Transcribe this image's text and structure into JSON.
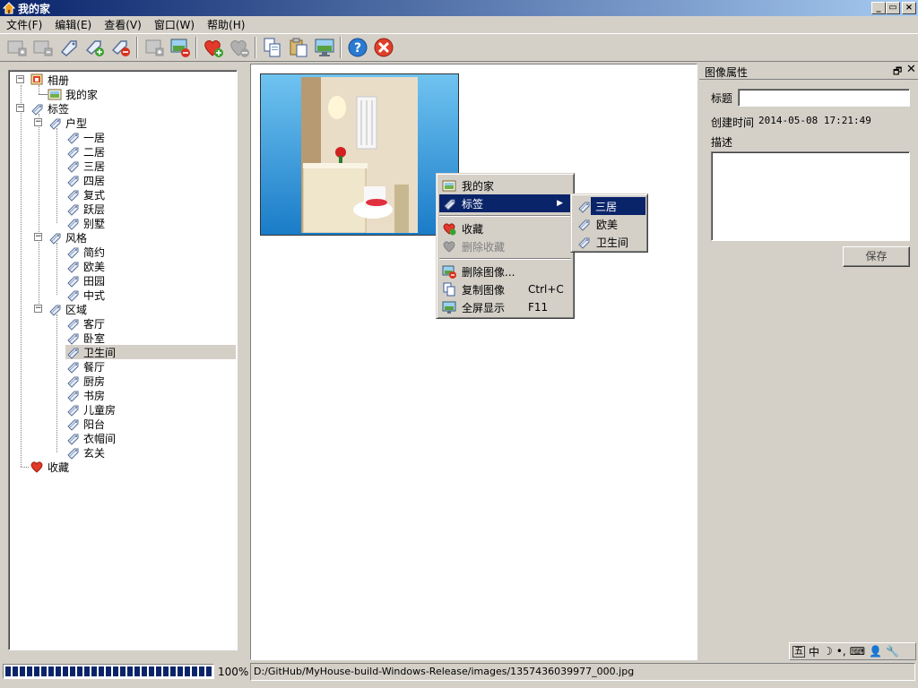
{
  "window": {
    "title": "我的家"
  },
  "menubar": {
    "items": [
      "文件(F)",
      "编辑(E)",
      "查看(V)",
      "窗口(W)",
      "帮助(H)"
    ]
  },
  "toolbar": {
    "buttons": [
      "new-album-icon",
      "remove-album-icon",
      "tag-icon",
      "add-tag-icon",
      "remove-tag-icon",
      "import-icon",
      "delete-image-icon",
      "add-favorite-icon",
      "remove-favorite-icon",
      "copy-icon",
      "paste-icon",
      "fullscreen-icon",
      "help-icon",
      "close-icon"
    ]
  },
  "tree": {
    "albums": {
      "label": "相册",
      "items": [
        "我的家"
      ]
    },
    "tags": {
      "label": "标签",
      "groups": [
        {
          "label": "户型",
          "items": [
            "一居",
            "二居",
            "三居",
            "四居",
            "复式",
            "跃层",
            "别墅"
          ]
        },
        {
          "label": "风格",
          "items": [
            "简约",
            "欧美",
            "田园",
            "中式"
          ]
        },
        {
          "label": "区域",
          "items": [
            "客厅",
            "卧室",
            "卫生间",
            "餐厅",
            "厨房",
            "书房",
            "儿童房",
            "阳台",
            "衣帽间",
            "玄关"
          ]
        }
      ]
    },
    "favorites": {
      "label": "收藏"
    },
    "selected": "卫生间"
  },
  "context_menu": {
    "items": [
      {
        "label": "我的家",
        "icon": "album-icon"
      },
      {
        "label": "标签",
        "icon": "tag-icon",
        "submenu": true
      },
      {
        "label": "收藏",
        "icon": "add-favorite-icon"
      },
      {
        "label": "删除收藏",
        "icon": "remove-favorite-icon",
        "disabled": true
      },
      {
        "label": "删除图像...",
        "icon": "delete-image-icon"
      },
      {
        "label": "复制图像",
        "shortcut": "Ctrl+C",
        "icon": "copy-icon"
      },
      {
        "label": "全屏显示",
        "shortcut": "F11",
        "icon": "fullscreen-icon"
      }
    ],
    "submenu": [
      "三居",
      "欧美",
      "卫生间"
    ]
  },
  "properties": {
    "panel_title": "图像属性",
    "title_label": "标题",
    "title_value": "",
    "created_label": "创建时间",
    "created_value": "2014-05-08 17:21:49",
    "desc_label": "描述",
    "desc_value": "",
    "save_label": "保存"
  },
  "status": {
    "progress_percent": 100,
    "progress_label": "100%",
    "path": "D:/GitHub/MyHouse-build-Windows-Release/images/1357436039977_000.jpg"
  },
  "ime": {
    "mode": "中"
  },
  "colors": {
    "selection": "#0a246a",
    "titlebar_start": "#0a246a",
    "titlebar_end": "#a6caf0",
    "face": "#d4d0c8"
  }
}
